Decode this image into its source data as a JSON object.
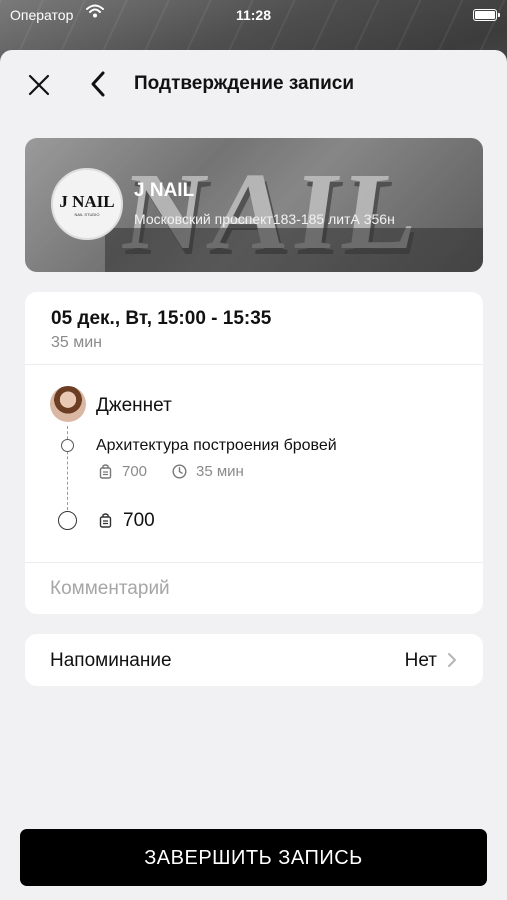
{
  "status_bar": {
    "carrier": "Оператор",
    "time": "11:28"
  },
  "header": {
    "title": "Подтверждение записи",
    "close_icon": "close-icon",
    "back_icon": "chevron-left-icon"
  },
  "salon": {
    "name": "J NAIL",
    "address": "Московский проспект183-185 литА 356н",
    "logo_text": "J NAIL",
    "logo_sub": "NAIL STUDIO"
  },
  "booking": {
    "datetime": "05 дек., Вт, 15:00 - 15:35",
    "duration": "35 мин",
    "master": {
      "name": "Дженнет"
    },
    "services": [
      {
        "name": "Архитектура построения бровей",
        "price": "700",
        "duration": "35 мин"
      }
    ],
    "total_price": "700",
    "comment": {
      "value": "",
      "placeholder": "Комментарий"
    }
  },
  "reminder": {
    "label": "Напоминание",
    "value": "Нет"
  },
  "submit": {
    "label": "ЗАВЕРШИТЬ ЗАПИСЬ"
  },
  "colors": {
    "sheet_background": "#f1f1f4",
    "card_background": "#ffffff",
    "primary_button": "#000000",
    "muted_text": "#8a8a8a"
  }
}
